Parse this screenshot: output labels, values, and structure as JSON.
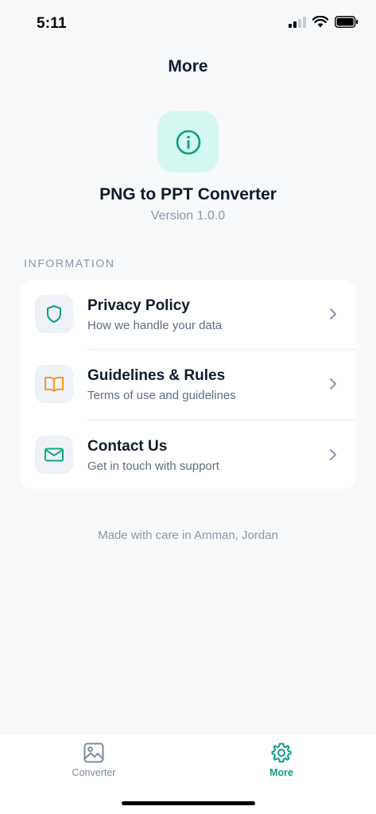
{
  "status": {
    "time": "5:11"
  },
  "header": {
    "title": "More"
  },
  "app": {
    "name": "PNG to PPT Converter",
    "version": "Version 1.0.0",
    "icon": "info-icon"
  },
  "section": {
    "label": "INFORMATION",
    "items": [
      {
        "title": "Privacy Policy",
        "subtitle": "How we handle your data",
        "icon": "shield-icon",
        "icon_color": "#12a08a"
      },
      {
        "title": "Guidelines & Rules",
        "subtitle": "Terms of use and guidelines",
        "icon": "book-icon",
        "icon_color": "#f29b1b"
      },
      {
        "title": "Contact Us",
        "subtitle": "Get in touch with support",
        "icon": "mail-icon",
        "icon_color": "#12a87e"
      }
    ]
  },
  "footer": {
    "note": "Made with care in Amman, Jordan"
  },
  "tabbar": {
    "tabs": [
      {
        "label": "Converter",
        "icon": "image-icon",
        "active": false
      },
      {
        "label": "More",
        "icon": "gear-icon",
        "active": true
      }
    ]
  },
  "colors": {
    "accent": "#0e9c8a",
    "accent_tint": "#d4f7f0",
    "background": "#f7f9fb"
  }
}
